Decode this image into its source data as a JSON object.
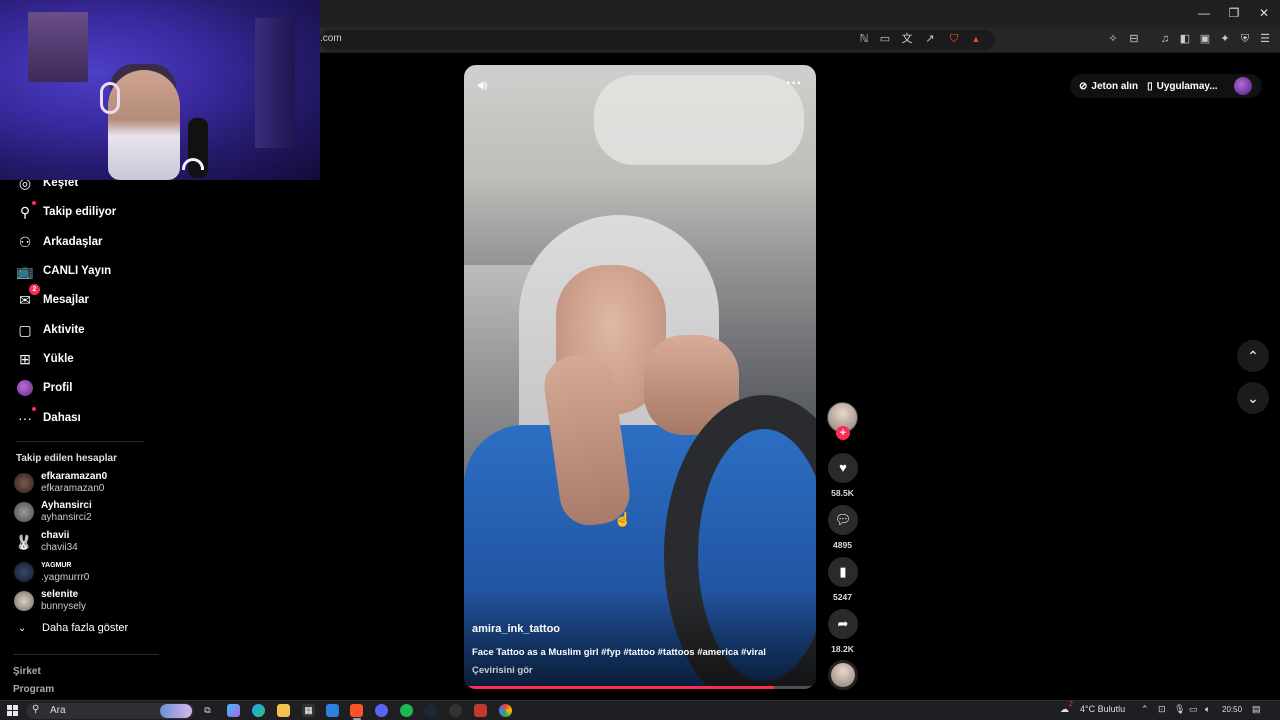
{
  "browser": {
    "url": ".com",
    "window_controls": [
      "minimize-icon",
      "restore-icon",
      "close-icon"
    ]
  },
  "sidebar": {
    "items": [
      {
        "label": "Keşfet",
        "icon": "compass-icon"
      },
      {
        "label": "Takip ediliyor",
        "icon": "following-icon"
      },
      {
        "label": "Arkadaşlar",
        "icon": "friends-icon"
      },
      {
        "label": "CANLI Yayın",
        "icon": "live-icon"
      },
      {
        "label": "Mesajlar",
        "icon": "messages-icon",
        "badge": "2"
      },
      {
        "label": "Aktivite",
        "icon": "activity-icon"
      },
      {
        "label": "Yükle",
        "icon": "upload-icon"
      },
      {
        "label": "Profil",
        "icon": "profile-avatar"
      },
      {
        "label": "Dahası",
        "icon": "more-icon"
      }
    ],
    "following_title": "Takip edilen hesaplar",
    "following": [
      {
        "name": "efkaramazan0",
        "handle": "efkaramazan0"
      },
      {
        "name": "Ayhansirci",
        "handle": "ayhansirci2"
      },
      {
        "name": "chavii",
        "handle": "chavii34"
      },
      {
        "name": "YAGMUR",
        "handle": ".yagmurrr0"
      },
      {
        "name": "selenite",
        "handle": "bunnysely"
      }
    ],
    "show_more": "Daha fazla göster",
    "footer": [
      "Şirket",
      "Program"
    ]
  },
  "topbar": {
    "coins_label": "Jeton alın",
    "app_label": "Uygulamay..."
  },
  "video": {
    "username": "amira_ink_tattoo",
    "caption": "Face Tattoo as a Muslim girl #fyp #tattoo #tattoos #america #viral",
    "translate": "Çevirisini gör",
    "progress": 0.88
  },
  "actions": {
    "likes": "58.5K",
    "comments": "4895",
    "saves": "5247",
    "shares": "18.2K"
  },
  "taskbar": {
    "search_placeholder": "Ara",
    "weather": "4°C  Bulutlu",
    "weather_badge": "2",
    "time": "20:50"
  },
  "colors": {
    "accent": "#fe2c55",
    "background": "#000000",
    "hoodie": "#2c6fc4"
  }
}
